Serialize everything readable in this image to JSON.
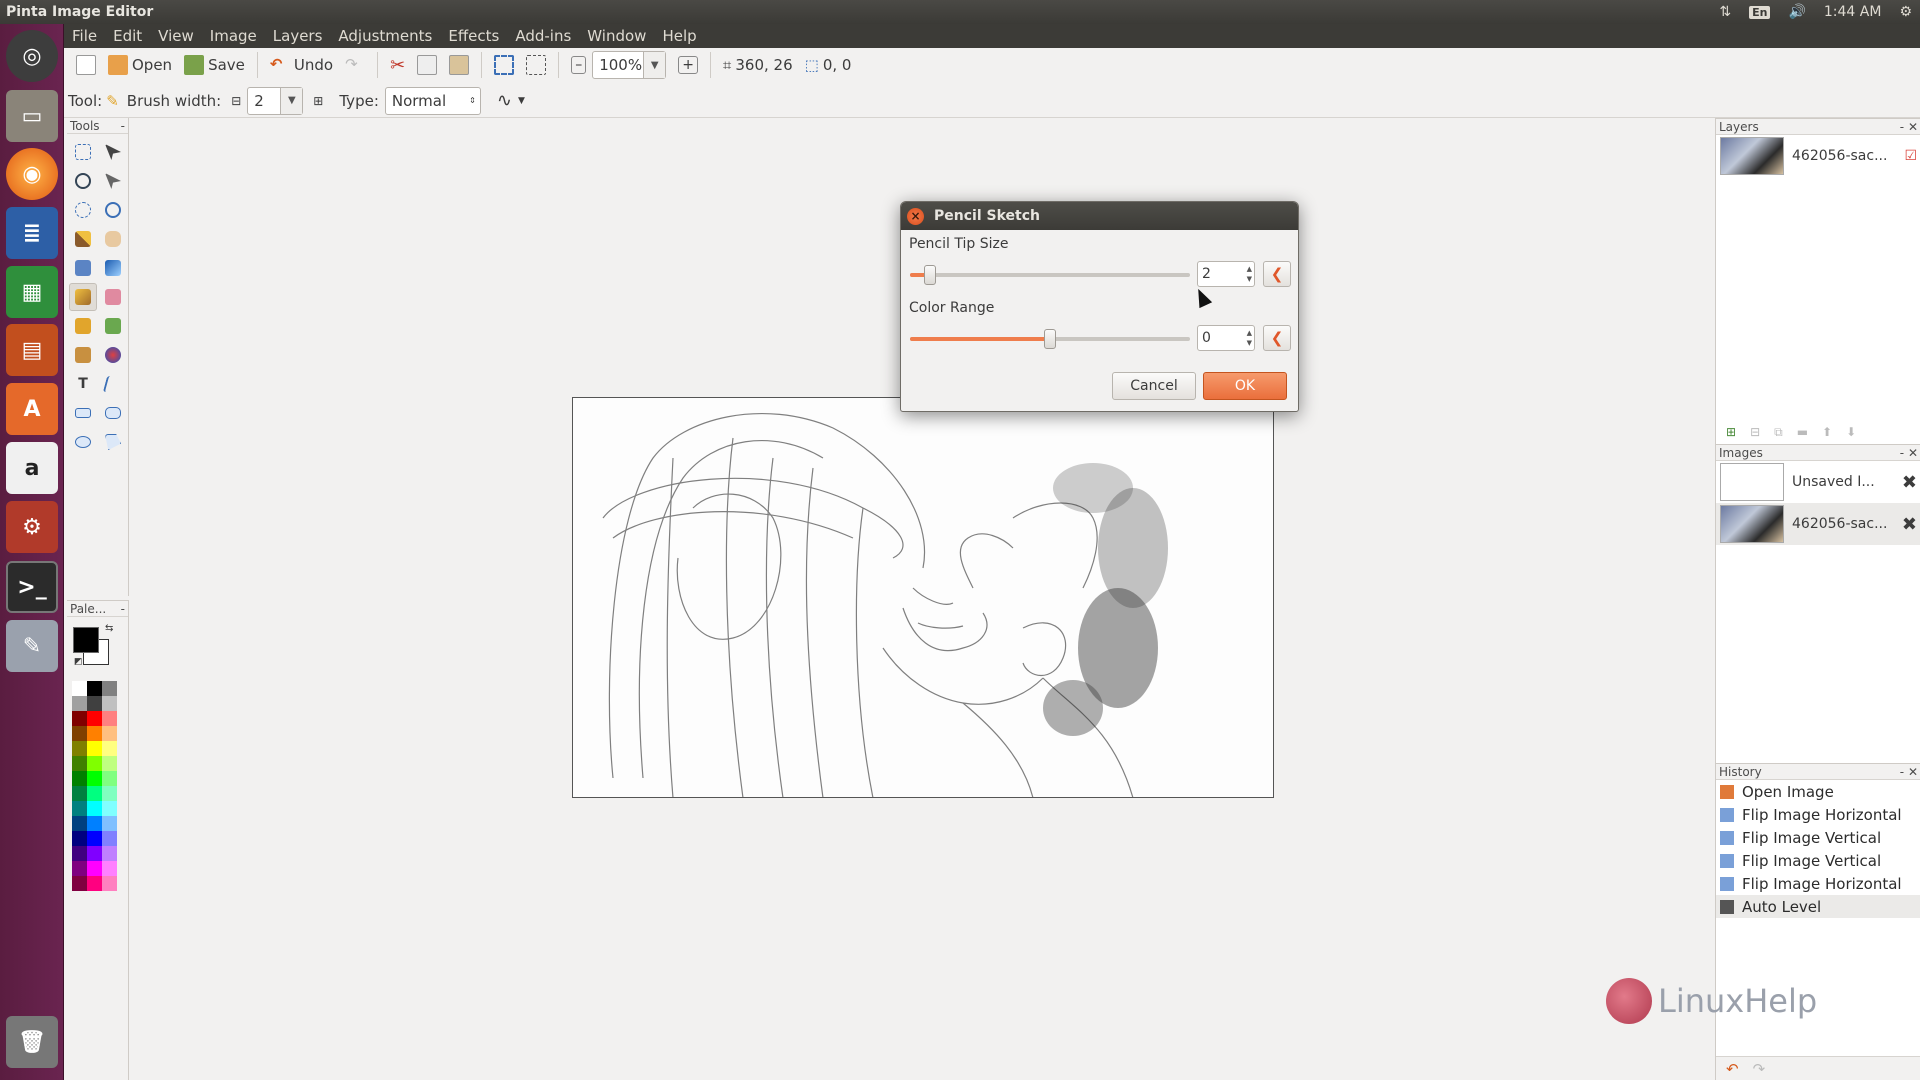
{
  "window": {
    "title": "Pinta Image Editor"
  },
  "system": {
    "keyboard": "En",
    "time": "1:44 AM"
  },
  "menu": [
    "File",
    "Edit",
    "View",
    "Image",
    "Layers",
    "Adjustments",
    "Effects",
    "Add-ins",
    "Window",
    "Help"
  ],
  "toolbar": {
    "open_label": "Open",
    "save_label": "Save",
    "undo_label": "Undo",
    "zoom_value": "100%",
    "cursor_position": "360, 26",
    "selection_size": "0, 0"
  },
  "tool_options": {
    "tool_label": "Tool:",
    "brush_width_label": "Brush width:",
    "brush_width_value": "2",
    "type_label": "Type:",
    "type_value": "Normal"
  },
  "panels": {
    "tools_title": "Tools",
    "palette_title": "Pale...",
    "layers_title": "Layers",
    "images_title": "Images",
    "history_title": "History"
  },
  "layers": [
    {
      "name": "462056-sac...",
      "visible": true
    }
  ],
  "images": [
    {
      "name": "Unsaved I..."
    },
    {
      "name": "462056-sac..."
    }
  ],
  "history": [
    {
      "label": "Open Image",
      "icon": "open-image-icon"
    },
    {
      "label": "Flip Image Horizontal",
      "icon": "flip-horizontal-icon"
    },
    {
      "label": "Flip Image Vertical",
      "icon": "flip-vertical-icon"
    },
    {
      "label": "Flip Image Vertical",
      "icon": "flip-vertical-icon"
    },
    {
      "label": "Flip Image Horizontal",
      "icon": "flip-horizontal-icon"
    },
    {
      "label": "Auto Level",
      "icon": "auto-level-icon",
      "selected": true
    }
  ],
  "dialog": {
    "title": "Pencil Sketch",
    "tip_size_label": "Pencil Tip Size",
    "tip_size_value": "2",
    "tip_size_fraction": 0.07,
    "color_range_label": "Color Range",
    "color_range_value": "0",
    "color_range_fraction": 0.5,
    "cancel_label": "Cancel",
    "ok_label": "OK"
  },
  "watermark": {
    "text": "LinuxHelp"
  },
  "colors": {
    "accent": "#ea6f3c",
    "launcher": "#5a1d40",
    "panel_bg": "#f2f1f0"
  }
}
